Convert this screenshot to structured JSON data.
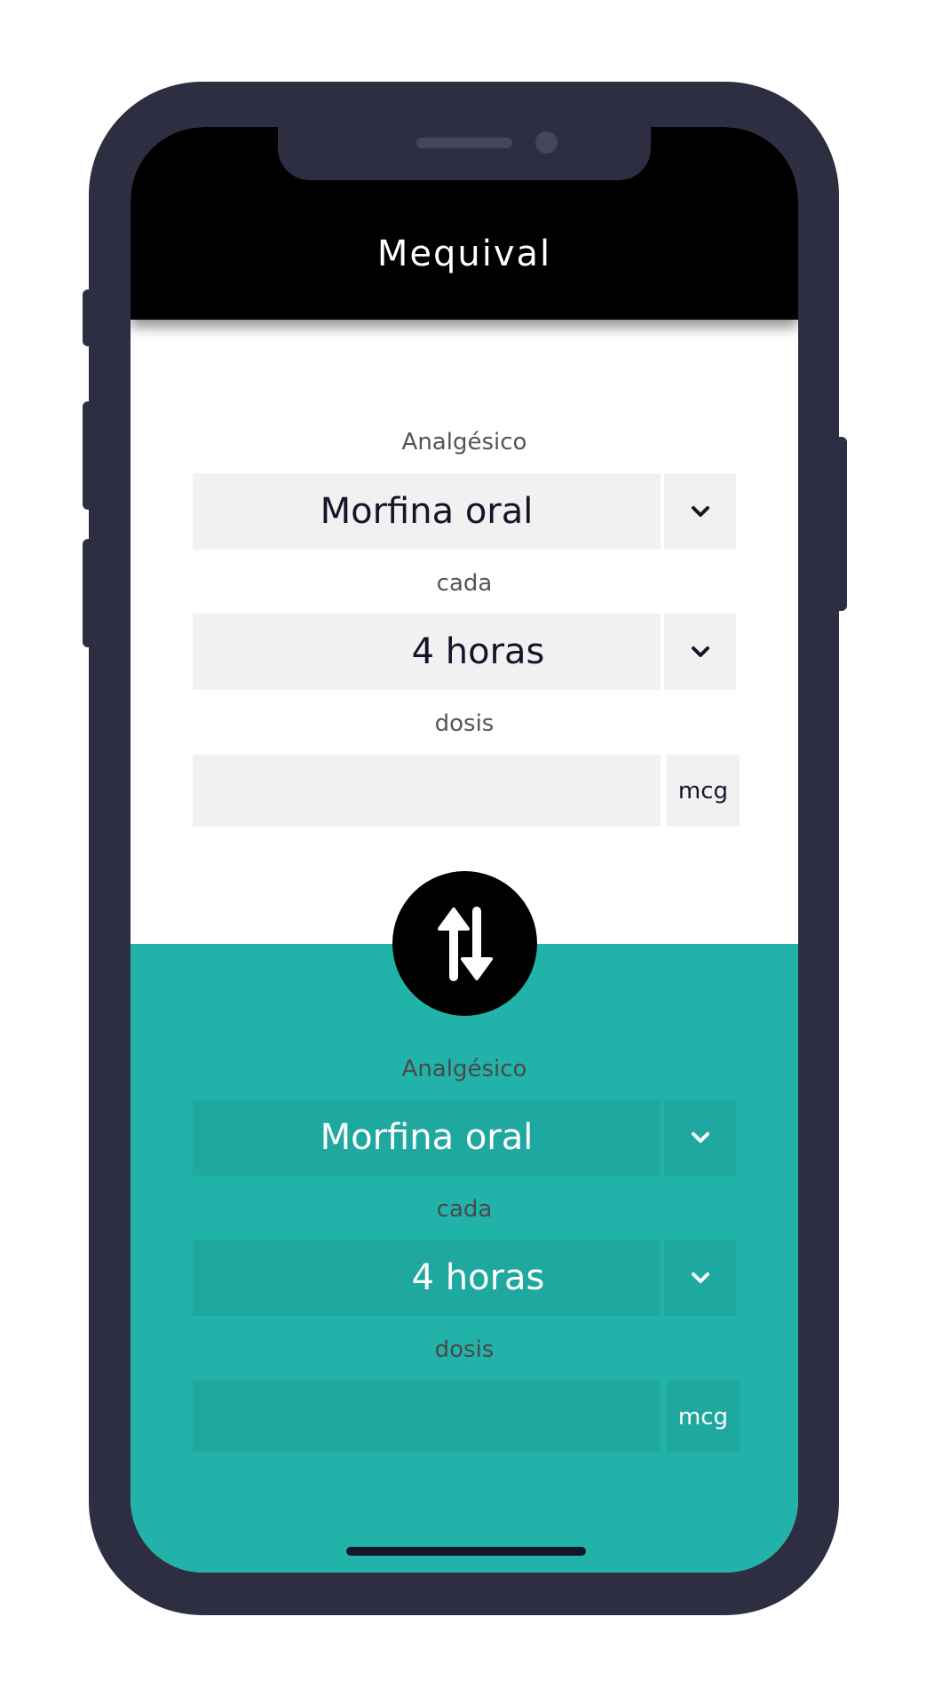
{
  "app": {
    "title": "Mequival"
  },
  "source": {
    "analgesic_label": "Analgésico",
    "analgesic_value": "Morfina oral",
    "interval_label": "cada",
    "interval_value": "4 horas",
    "dose_label": "dosis",
    "dose_value": "",
    "dose_unit": "mcg"
  },
  "target": {
    "analgesic_label": "Analgésico",
    "analgesic_value": "Morfina oral",
    "interval_label": "cada",
    "interval_value": "4 horas",
    "dose_label": "dosis",
    "dose_value": "",
    "dose_unit": "mcg"
  },
  "icons": {
    "swap": "swap-vertical-icon",
    "dropdown": "chevron-down-icon"
  },
  "colors": {
    "header": "#000000",
    "accent": "#21b2a9",
    "field_bg": "#f1f1f1",
    "frame": "#2e2e42"
  }
}
